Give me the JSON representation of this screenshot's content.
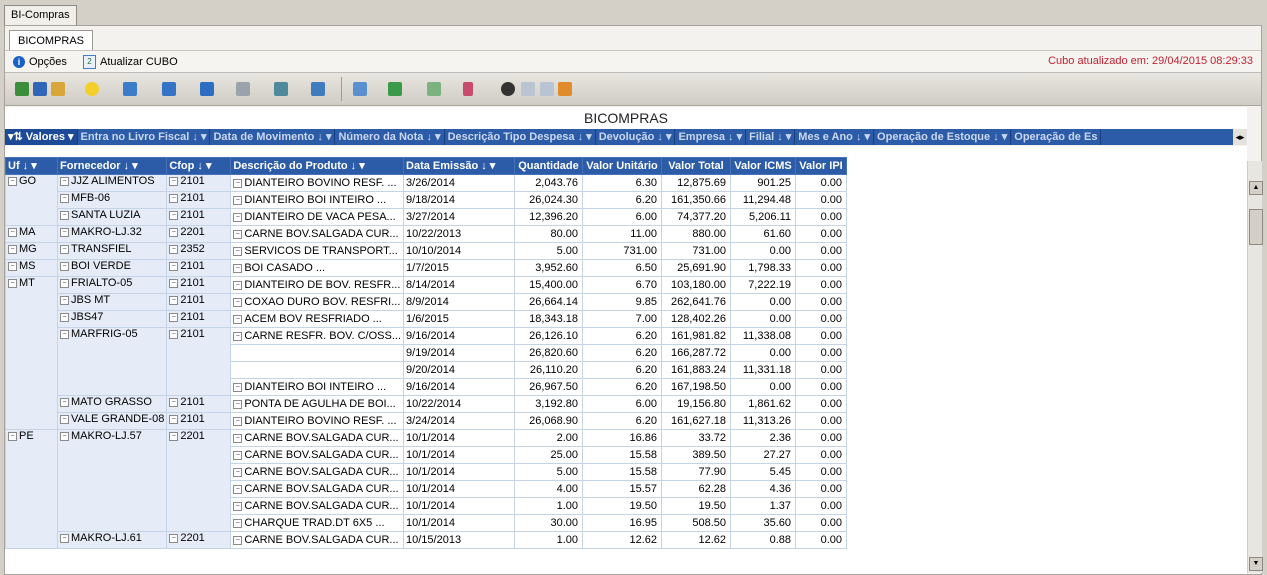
{
  "window": {
    "tab": "BI-Compras"
  },
  "subtab": "BICOMPRAS",
  "options": {
    "opcoes": "Opções",
    "atualizar": "Atualizar CUBO",
    "cubo_status": "Cubo atualizado em: 29/04/2015 08:29:33"
  },
  "toolbar_icons": [
    "new-icon",
    "save-icon",
    "open-icon",
    "star-icon",
    "export-icon",
    "save-layout-icon",
    "add-icon",
    "excel-icon",
    "report-icon",
    "chart-icon",
    "refresh-icon",
    "add-dropdown-icon",
    "pivot-icon",
    "filter-icon",
    "view-icon",
    "grid-icon",
    "columns-icon",
    "bar-chart-icon"
  ],
  "report_title": "BICOMPRAS",
  "filter_fields": [
    "Valores",
    "Entra no Livro Fiscal",
    "Data de Movimento",
    "Número da Nota",
    "Descrição Tipo Despesa",
    "Devolução",
    "Empresa",
    "Filial",
    "Mes e Ano",
    "Operação de Estoque",
    "Operação de Es"
  ],
  "headers": [
    "Uf",
    "Fornecedor",
    "Cfop",
    "Descrição do Produto",
    "Data Emissão",
    "Quantidade",
    "Valor Unitário",
    "Valor Total",
    "Valor ICMS",
    "Valor IPI"
  ],
  "rows": [
    {
      "uf": "GO",
      "forn": "JJZ ALIMENTOS",
      "cfop": "2101",
      "prod": "DIANTEIRO BOVINO RESF. ...",
      "data": "3/26/2014",
      "qtd": "2,043.76",
      "vu": "6.30",
      "vt": "12,875.69",
      "icms": "901.25",
      "ipi": "0.00"
    },
    {
      "uf": "",
      "forn": "MFB-06",
      "cfop": "2101",
      "prod": "DIANTEIRO BOI INTEIRO   ...",
      "data": "9/18/2014",
      "qtd": "26,024.30",
      "vu": "6.20",
      "vt": "161,350.66",
      "icms": "11,294.48",
      "ipi": "0.00"
    },
    {
      "uf": "",
      "forn": "SANTA LUZIA",
      "cfop": "2101",
      "prod": "DIANTEIRO DE VACA PESA...",
      "data": "3/27/2014",
      "qtd": "12,396.20",
      "vu": "6.00",
      "vt": "74,377.20",
      "icms": "5,206.11",
      "ipi": "0.00"
    },
    {
      "uf": "MA",
      "forn": "MAKRO-LJ.32",
      "cfop": "2201",
      "prod": "CARNE BOV.SALGADA CUR...",
      "data": "10/22/2013",
      "qtd": "80.00",
      "vu": "11.00",
      "vt": "880.00",
      "icms": "61.60",
      "ipi": "0.00"
    },
    {
      "uf": "MG",
      "forn": "TRANSFIEL",
      "cfop": "2352",
      "prod": "SERVICOS DE TRANSPORT...",
      "data": "10/10/2014",
      "qtd": "5.00",
      "vu": "731.00",
      "vt": "731.00",
      "icms": "0.00",
      "ipi": "0.00"
    },
    {
      "uf": "MS",
      "forn": "BOI VERDE",
      "cfop": "2101",
      "prod": "BOI CASADO              ...",
      "data": "1/7/2015",
      "qtd": "3,952.60",
      "vu": "6.50",
      "vt": "25,691.90",
      "icms": "1,798.33",
      "ipi": "0.00"
    },
    {
      "uf": "MT",
      "forn": "FRIALTO-05",
      "cfop": "2101",
      "prod": "DIANTEIRO DE BOV. RESFR...",
      "data": "8/14/2014",
      "qtd": "15,400.00",
      "vu": "6.70",
      "vt": "103,180.00",
      "icms": "7,222.19",
      "ipi": "0.00"
    },
    {
      "uf": "",
      "forn": "JBS MT",
      "cfop": "2101",
      "prod": "COXAO DURO BOV. RESFRI...",
      "data": "8/9/2014",
      "qtd": "26,664.14",
      "vu": "9.85",
      "vt": "262,641.76",
      "icms": "0.00",
      "ipi": "0.00"
    },
    {
      "uf": "",
      "forn": "JBS47",
      "cfop": "2101",
      "prod": "ACEM BOV RESFRIADO      ...",
      "data": "1/6/2015",
      "qtd": "18,343.18",
      "vu": "7.00",
      "vt": "128,402.26",
      "icms": "0.00",
      "ipi": "0.00"
    },
    {
      "uf": "",
      "forn": "MARFRIG-05",
      "cfop": "2101",
      "prod": "CARNE RESFR. BOV. C/OSS...",
      "data": "9/16/2014",
      "qtd": "26,126.10",
      "vu": "6.20",
      "vt": "161,981.82",
      "icms": "11,338.08",
      "ipi": "0.00"
    },
    {
      "uf": "",
      "forn": "",
      "cfop": "",
      "prod": "",
      "data": "9/19/2014",
      "qtd": "26,820.60",
      "vu": "6.20",
      "vt": "166,287.72",
      "icms": "0.00",
      "ipi": "0.00"
    },
    {
      "uf": "",
      "forn": "",
      "cfop": "",
      "prod": "",
      "data": "9/20/2014",
      "qtd": "26,110.20",
      "vu": "6.20",
      "vt": "161,883.24",
      "icms": "11,331.18",
      "ipi": "0.00"
    },
    {
      "uf": "",
      "forn": "",
      "cfop": "",
      "prod": "DIANTEIRO BOI INTEIRO   ...",
      "data": "9/16/2014",
      "qtd": "26,967.50",
      "vu": "6.20",
      "vt": "167,198.50",
      "icms": "0.00",
      "ipi": "0.00"
    },
    {
      "uf": "",
      "forn": "MATO GRASSO",
      "cfop": "2101",
      "prod": "PONTA DE AGULHA  DE BOI...",
      "data": "10/22/2014",
      "qtd": "3,192.80",
      "vu": "6.00",
      "vt": "19,156.80",
      "icms": "1,861.62",
      "ipi": "0.00"
    },
    {
      "uf": "",
      "forn": "VALE GRANDE-08",
      "cfop": "2101",
      "prod": "DIANTEIRO BOVINO RESF. ...",
      "data": "3/24/2014",
      "qtd": "26,068.90",
      "vu": "6.20",
      "vt": "161,627.18",
      "icms": "11,313.26",
      "ipi": "0.00"
    },
    {
      "uf": "PE",
      "forn": "MAKRO-LJ.57",
      "cfop": "2201",
      "prod": "CARNE BOV.SALGADA CUR...",
      "data": "10/1/2014",
      "qtd": "2.00",
      "vu": "16.86",
      "vt": "33.72",
      "icms": "2.36",
      "ipi": "0.00"
    },
    {
      "uf": "",
      "forn": "",
      "cfop": "",
      "prod": "CARNE BOV.SALGADA CUR...",
      "data": "10/1/2014",
      "qtd": "25.00",
      "vu": "15.58",
      "vt": "389.50",
      "icms": "27.27",
      "ipi": "0.00"
    },
    {
      "uf": "",
      "forn": "",
      "cfop": "",
      "prod": "CARNE BOV.SALGADA CUR...",
      "data": "10/1/2014",
      "qtd": "5.00",
      "vu": "15.58",
      "vt": "77.90",
      "icms": "5.45",
      "ipi": "0.00"
    },
    {
      "uf": "",
      "forn": "",
      "cfop": "",
      "prod": "CARNE BOV.SALGADA CUR...",
      "data": "10/1/2014",
      "qtd": "4.00",
      "vu": "15.57",
      "vt": "62.28",
      "icms": "4.36",
      "ipi": "0.00"
    },
    {
      "uf": "",
      "forn": "",
      "cfop": "",
      "prod": "CARNE BOV.SALGADA CUR...",
      "data": "10/1/2014",
      "qtd": "1.00",
      "vu": "19.50",
      "vt": "19.50",
      "icms": "1.37",
      "ipi": "0.00"
    },
    {
      "uf": "",
      "forn": "",
      "cfop": "",
      "prod": "CHARQUE TRAD.DT 6X5     ...",
      "data": "10/1/2014",
      "qtd": "30.00",
      "vu": "16.95",
      "vt": "508.50",
      "icms": "35.60",
      "ipi": "0.00"
    },
    {
      "uf": "",
      "forn": "MAKRO-LJ.61",
      "cfop": "2201",
      "prod": "CARNE BOV.SALGADA CUR...",
      "data": "10/15/2013",
      "qtd": "1.00",
      "vu": "12.62",
      "vt": "12.62",
      "icms": "0.88",
      "ipi": "0.00"
    }
  ],
  "colors": {
    "header_blue": "#2c5ba8",
    "row_header": "#e5ecf7",
    "status_red": "#c2212e"
  }
}
